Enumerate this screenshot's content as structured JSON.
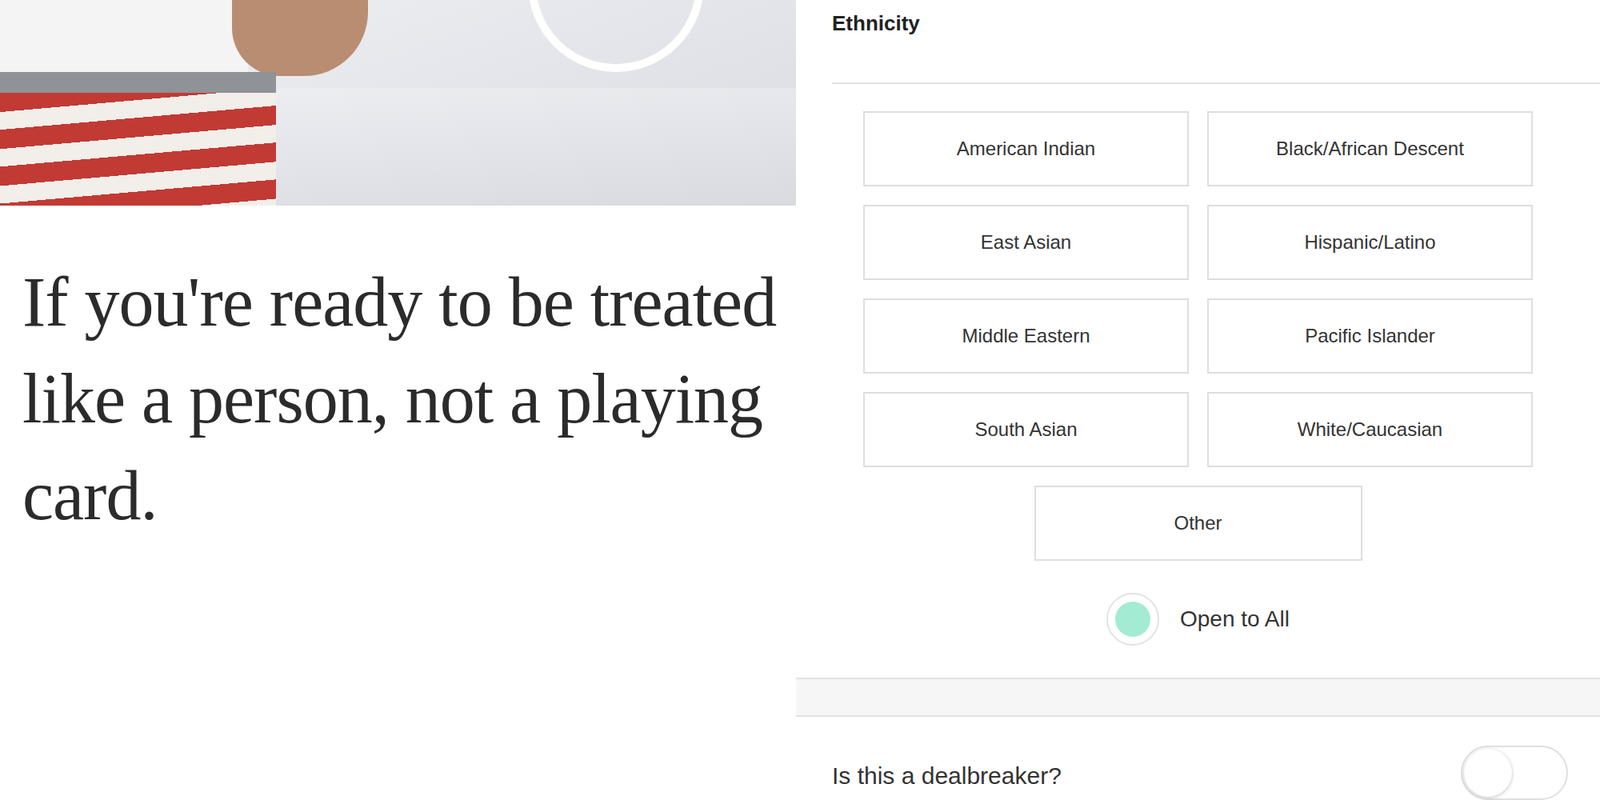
{
  "headline": "If you're ready to be treated like a person, not a playing card.",
  "filter": {
    "title": "Ethnicity",
    "options": [
      {
        "label": "American Indian",
        "selected": false
      },
      {
        "label": "Black/African Descent",
        "selected": false
      },
      {
        "label": "East Asian",
        "selected": false
      },
      {
        "label": "Hispanic/Latino",
        "selected": false
      },
      {
        "label": "Middle Eastern",
        "selected": false
      },
      {
        "label": "Pacific Islander",
        "selected": false
      },
      {
        "label": "South Asian",
        "selected": false
      },
      {
        "label": "White/Caucasian",
        "selected": false
      },
      {
        "label": "Other",
        "selected": false
      }
    ],
    "open_to_all": {
      "label": "Open to All",
      "selected": true
    }
  },
  "dealbreaker": {
    "label": "Is this a dealbreaker?",
    "on": false
  }
}
